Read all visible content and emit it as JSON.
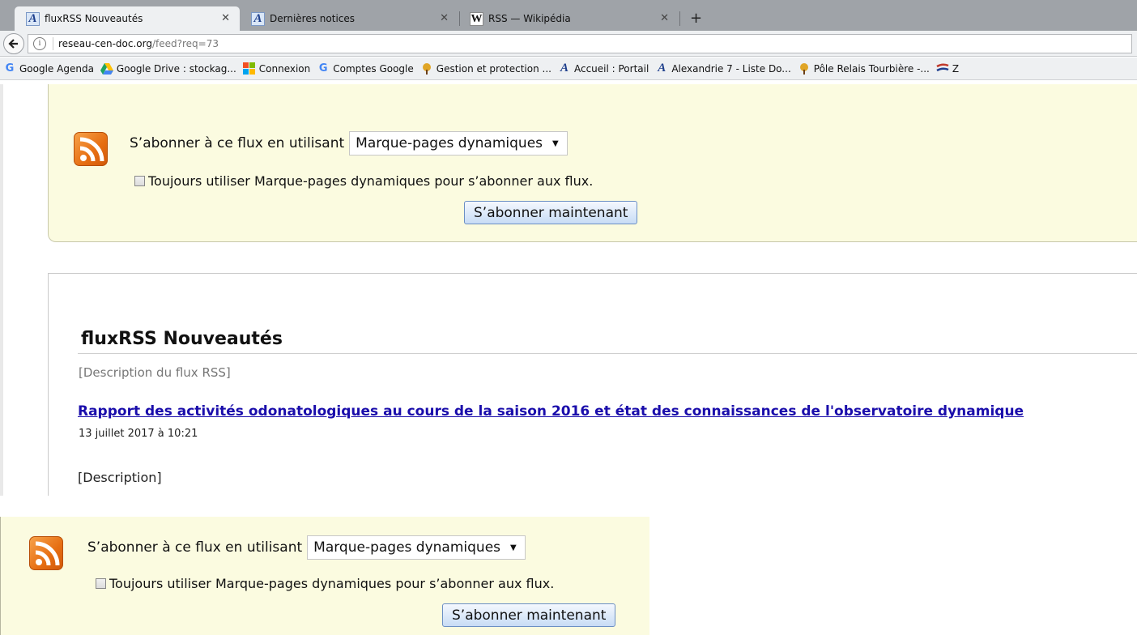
{
  "browser": {
    "tabs": [
      {
        "label": "fluxRSS Nouveautés",
        "active": true,
        "favicon": "alexandrie-a-icon"
      },
      {
        "label": "Dernières notices",
        "active": false,
        "favicon": "alexandrie-a-icon"
      },
      {
        "label": "RSS — Wikipédia",
        "active": false,
        "favicon": "wikipedia-w-icon"
      }
    ],
    "url_host": "reseau-cen-doc.org",
    "url_path": "/feed?req=73",
    "bookmarks": [
      {
        "label": "Google Agenda",
        "icon": "google-icon"
      },
      {
        "label": "Google Drive : stockag...",
        "icon": "google-drive-icon"
      },
      {
        "label": "Connexion",
        "icon": "microsoft-icon"
      },
      {
        "label": "Comptes Google",
        "icon": "google-icon"
      },
      {
        "label": "Gestion et protection ...",
        "icon": "tree-icon"
      },
      {
        "label": "Accueil : Portail",
        "icon": "alexandrie-a-icon"
      },
      {
        "label": "Alexandrie 7 - Liste Do...",
        "icon": "alexandrie-a-icon"
      },
      {
        "label": "Pôle Relais Tourbière -...",
        "icon": "tree-icon"
      },
      {
        "label": "Z",
        "icon": "z-logo-icon"
      }
    ]
  },
  "subscribe": {
    "prompt": "S’abonner à ce flux en utilisant",
    "reader": "Marque-pages dynamiques",
    "always_label": "Toujours utiliser Marque-pages dynamiques pour s’abonner aux flux.",
    "always_checked": false,
    "button": "S’abonner maintenant"
  },
  "feed": {
    "title": "fluxRSS Nouveautés",
    "description": "[Description du flux RSS]",
    "entries": [
      {
        "title": "Rapport des activités odonatologiques au cours de la saison 2016 et état des connaissances de l'observatoire dynamique",
        "date": "13 juillet 2017 à 10:21",
        "description": "[Description]"
      }
    ]
  },
  "colors": {
    "notice_bg": "#fbfbe0",
    "link": "#1a0dab",
    "rss_orange": "#e66e12"
  }
}
